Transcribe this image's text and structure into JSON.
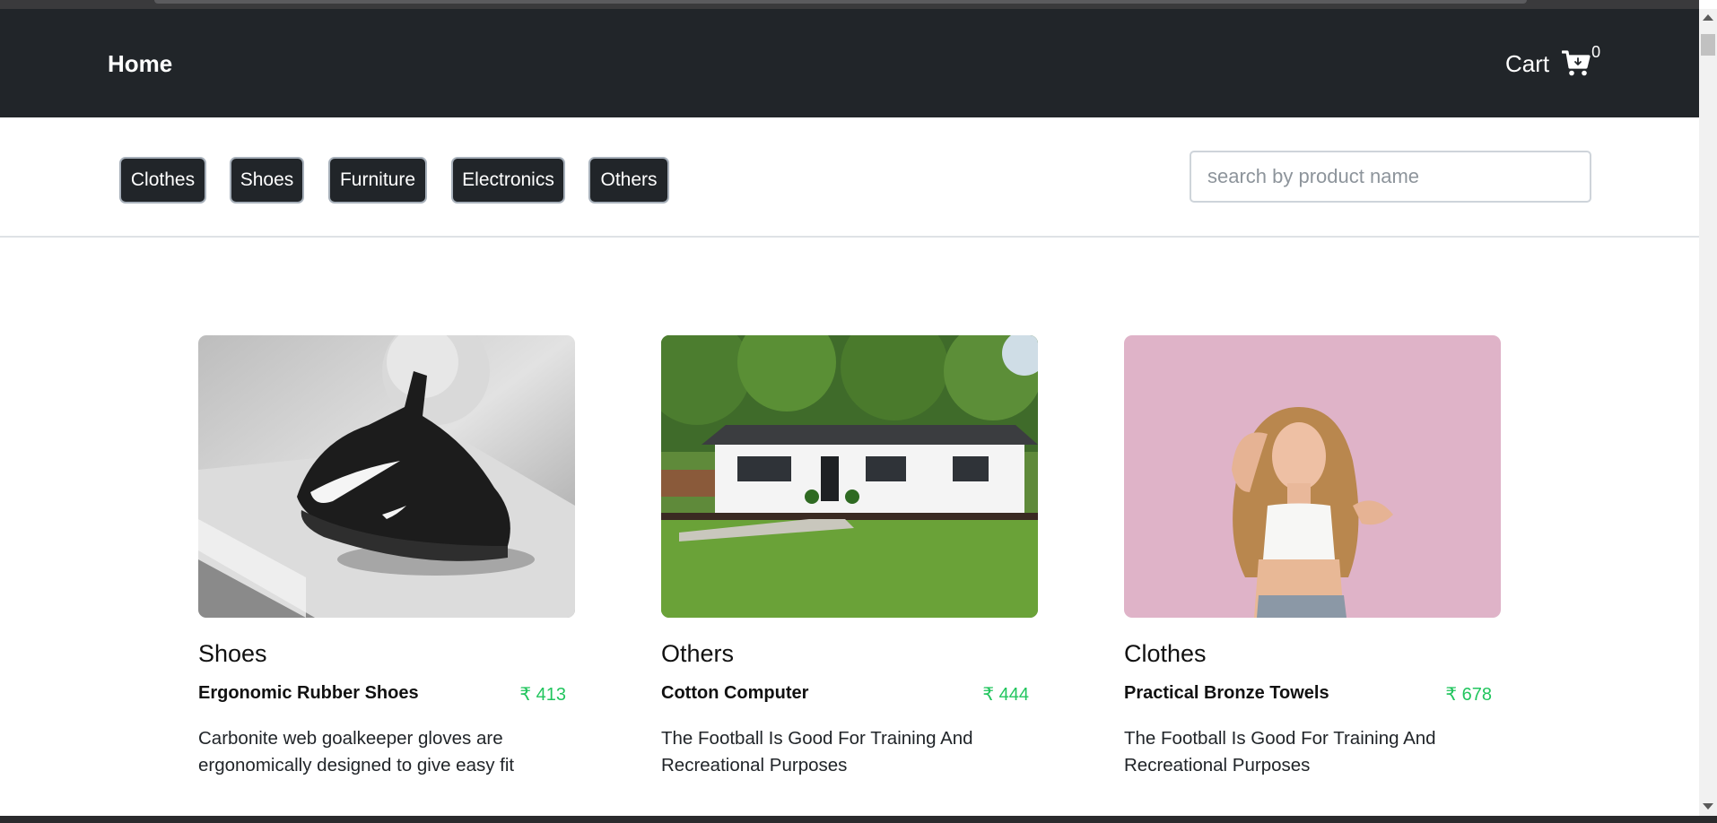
{
  "navbar": {
    "home_label": "Home",
    "cart_label": "Cart",
    "cart_count": "0",
    "bg_color": "#212529"
  },
  "filters": {
    "categories": [
      "Clothes",
      "Shoes",
      "Furniture",
      "Electronics",
      "Others"
    ],
    "search_placeholder": "search by product name",
    "search_value": ""
  },
  "products": [
    {
      "category": "Shoes",
      "name": "Ergonomic Rubber Shoes",
      "price": "₹ 413",
      "description": "Carbonite web goalkeeper gloves are ergonomically designed to give easy fit",
      "image": "black-sneaker-photo"
    },
    {
      "category": "Others",
      "name": "Cotton Computer",
      "price": "₹ 444",
      "description": "The Football Is Good For Training And Recreational Purposes",
      "image": "white-house-photo"
    },
    {
      "category": "Clothes",
      "name": "Practical Bronze Towels",
      "price": "₹ 678",
      "description": "The Football Is Good For Training And Recreational Purposes",
      "image": "woman-portrait-photo"
    }
  ],
  "colors": {
    "price": "#22c55e",
    "button_bg": "#212529"
  }
}
